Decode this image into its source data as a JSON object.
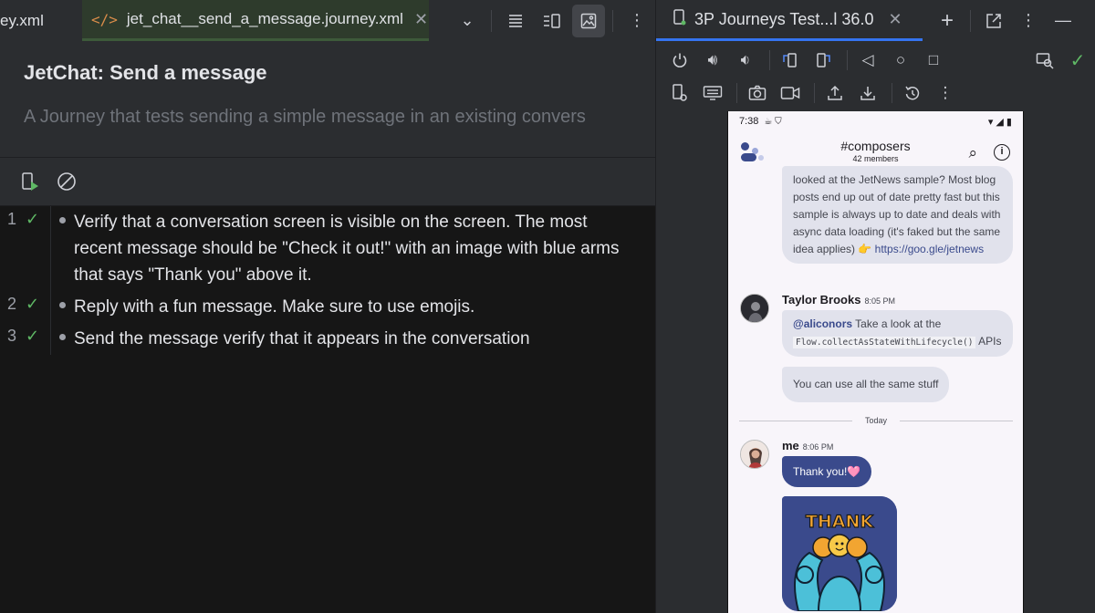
{
  "editor": {
    "tabs": [
      {
        "label": "ey.xml"
      },
      {
        "label": "jet_chat__send_a_message.journey.xml",
        "icon": "code-icon"
      }
    ]
  },
  "journey": {
    "title": "JetChat: Send a message",
    "description": "A Journey that tests sending a simple message in an existing convers",
    "steps": [
      {
        "number": "1",
        "text": "Verify that a conversation screen is visible on the screen. The most recent message should be \"Check it out!\" with an image with blue arms that says \"Thank you\" above it.",
        "status": "passed"
      },
      {
        "number": "2",
        "text": "Reply with a fun message. Make sure to use emojis.",
        "status": "passed"
      },
      {
        "number": "3",
        "text": "Send the message verify that it appears in the conversation",
        "status": "passed"
      }
    ]
  },
  "device_panel": {
    "tab_label": "3P Journeys Test...l 36.0"
  },
  "phone": {
    "status_time": "7:38",
    "channel": "#composers",
    "members": "42 members",
    "messages": {
      "first_text": "looked at the JetNews sample? Most blog posts end up out of date pretty fast but this sample is always up to date and deals with async data loading (it's faked but the same idea applies) 👉",
      "first_link": "https://goo.gle/jetnews",
      "taylor_name": "Taylor Brooks",
      "taylor_time": "8:05 PM",
      "mention": "@aliconors",
      "taylor_text": " Take a look at the",
      "code": "Flow.collectAsStateWithLifecycle()",
      "apis": " APIs",
      "taylor_text2": "You can use all the same stuff",
      "day_label": "Today",
      "me_name": "me",
      "me_time": "8:06 PM",
      "me_text": "Thank you!🩷",
      "sticker_text": "THANK YOU"
    }
  },
  "colors": {
    "accent_blue": "#3574f0",
    "pass_green": "#5fb865",
    "jetchat_primary": "#3a4a8c"
  }
}
